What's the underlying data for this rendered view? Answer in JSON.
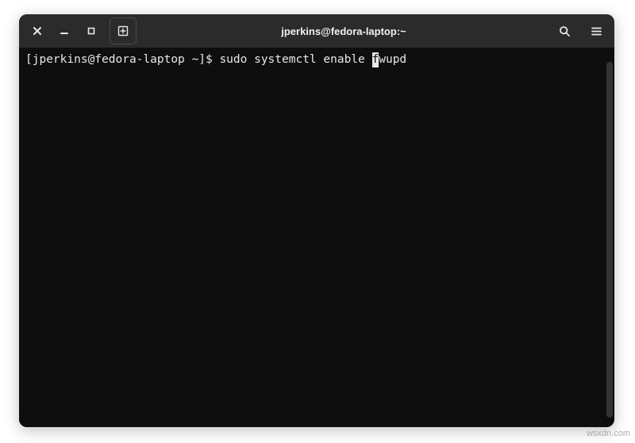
{
  "window": {
    "title": "jperkins@fedora-laptop:~"
  },
  "terminal": {
    "prompt": "[jperkins@fedora-laptop ~]$ ",
    "command_before_cursor": "sudo systemctl enable ",
    "cursor_char": "f",
    "command_after_cursor": "wupd"
  },
  "watermark": "wsxdn.com"
}
